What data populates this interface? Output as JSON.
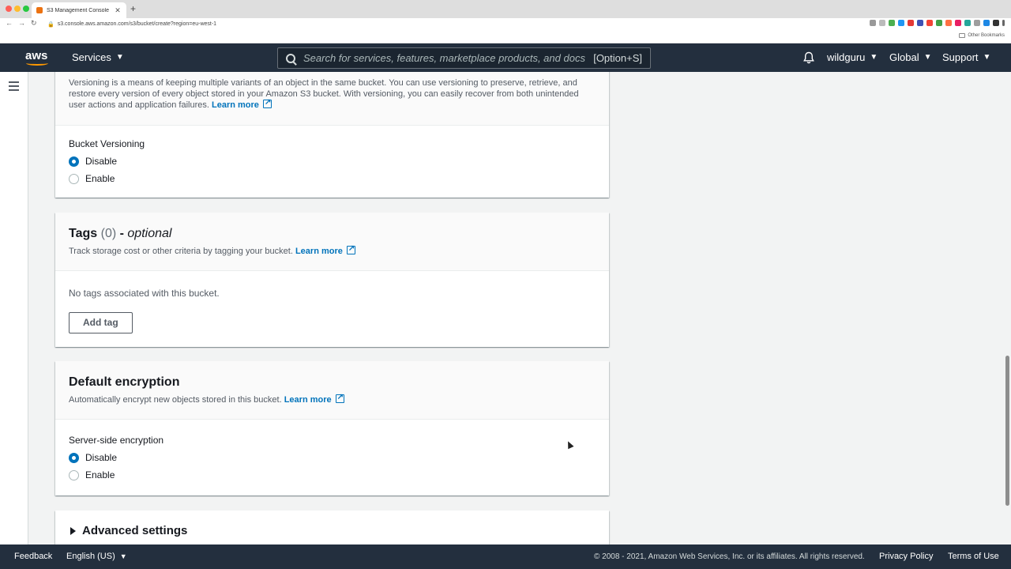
{
  "browser": {
    "tab_title": "S3 Management Console",
    "tab_close": "✕",
    "new_tab": "+",
    "url": "s3.console.aws.amazon.com/s3/bucket/create?region=eu-west-1",
    "nav_back": "←",
    "nav_forward": "→",
    "nav_reload": "↻",
    "other_bookmarks": "Other Bookmarks"
  },
  "topnav": {
    "logo": "aws",
    "services_label": "Services",
    "search_placeholder": "Search for services, features, marketplace products, and docs",
    "search_shortcut": "[Option+S]",
    "account": "wildguru",
    "region": "Global",
    "support": "Support",
    "caret": "▼"
  },
  "versioning": {
    "description": "Versioning is a means of keeping multiple variants of an object in the same bucket. You can use versioning to preserve, retrieve, and restore every version of every object stored in your Amazon S3 bucket. With versioning, you can easily recover from both unintended user actions and application failures.",
    "learn_more": "Learn more",
    "field_label": "Bucket Versioning",
    "options": [
      "Disable",
      "Enable"
    ],
    "selected": "Disable"
  },
  "tags": {
    "title": "Tags",
    "count": "(0)",
    "dash": "-",
    "optional": "optional",
    "description": "Track storage cost or other criteria by tagging your bucket.",
    "learn_more": "Learn more",
    "empty_text": "No tags associated with this bucket.",
    "add_button": "Add tag"
  },
  "encryption": {
    "title": "Default encryption",
    "description": "Automatically encrypt new objects stored in this bucket.",
    "learn_more": "Learn more",
    "field_label": "Server-side encryption",
    "options": [
      "Disable",
      "Enable"
    ],
    "selected": "Disable"
  },
  "advanced": {
    "title": "Advanced settings"
  },
  "footer": {
    "feedback": "Feedback",
    "language": "English (US)",
    "caret": "▼",
    "copyright": "© 2008 - 2021, Amazon Web Services, Inc. or its affiliates. All rights reserved.",
    "privacy": "Privacy Policy",
    "terms": "Terms of Use"
  },
  "colors": {
    "nav_bg": "#232f3e",
    "link": "#0073bb",
    "accent": "#ff9900"
  }
}
